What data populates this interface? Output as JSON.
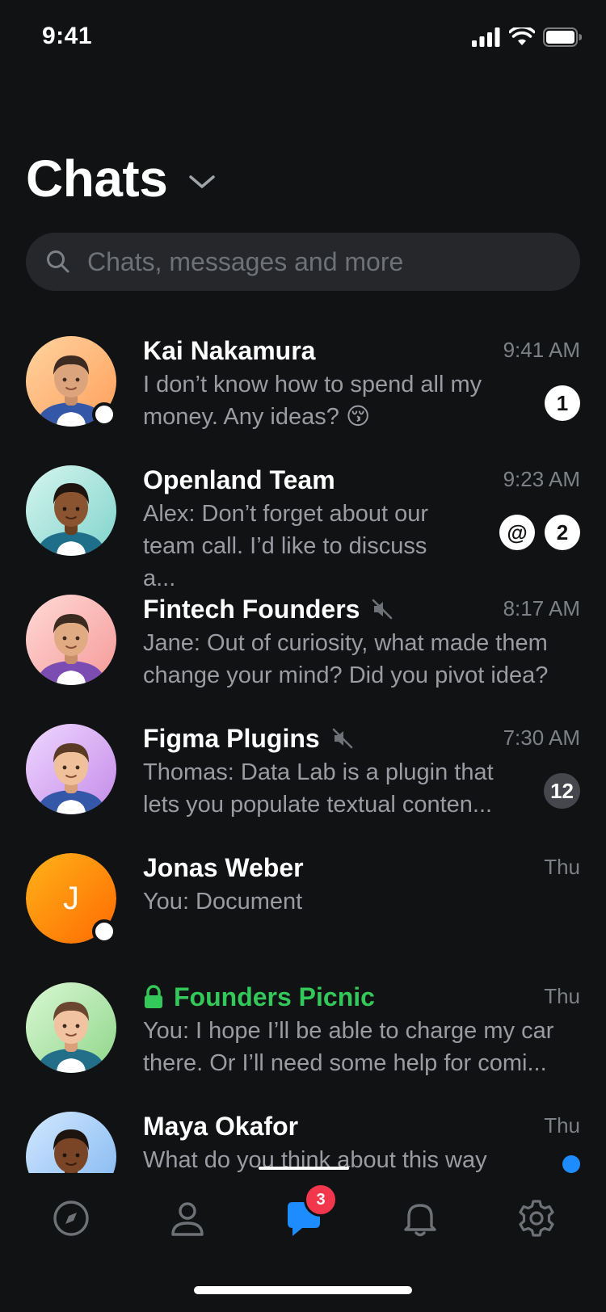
{
  "status_bar": {
    "time": "9:41"
  },
  "header": {
    "title": "Chats"
  },
  "search": {
    "placeholder": "Chats, messages and more"
  },
  "chats": [
    {
      "name": "Kai Nakamura",
      "time": "9:41 AM",
      "preview": "I don’t know how to spend all my money. Any ideas? 😚",
      "badges": [
        "1"
      ],
      "online": true,
      "muted": false
    },
    {
      "name": "Openland Team",
      "time": "9:23 AM",
      "preview": "Alex: Don’t forget about our team call. I’d like to discuss a...",
      "badges": [
        "@",
        "2"
      ],
      "online": false,
      "muted": false
    },
    {
      "name": "Fintech Founders",
      "time": "8:17 AM",
      "preview": "Jane: Out of curiosity, what made them change your mind? Did you pivot idea?",
      "badges": [],
      "online": false,
      "muted": true
    },
    {
      "name": "Figma Plugins",
      "time": "7:30 AM",
      "preview": "Thomas: Data Lab is a plugin that lets you populate textual conten...",
      "badges": [
        "12"
      ],
      "online": false,
      "muted": true
    },
    {
      "name": "Jonas Weber",
      "time": "Thu",
      "preview": "You: Document",
      "avatar_letter": "J",
      "badges": [],
      "online": true,
      "muted": false
    },
    {
      "name": "Founders Picnic",
      "time": "Thu",
      "preview": "You: I hope I’ll be able to charge my car there. Or I’ll need some help for comi...",
      "badges": [],
      "online": false,
      "muted": false,
      "secret": true
    },
    {
      "name": "Maya Okafor",
      "time": "Thu",
      "preview": "What do you think about this way",
      "badges": [],
      "online": false,
      "muted": false,
      "unread_dot": true
    }
  ],
  "tabbar": {
    "items": [
      {
        "id": "discover",
        "icon": "compass-icon"
      },
      {
        "id": "profile",
        "icon": "person-icon"
      },
      {
        "id": "chats",
        "icon": "chat-bubble-icon",
        "badge": "3",
        "active": true
      },
      {
        "id": "notifications",
        "icon": "bell-icon"
      },
      {
        "id": "settings",
        "icon": "gear-icon"
      }
    ]
  },
  "colors": {
    "background": "#111214",
    "accent": "#1c8cff",
    "secret_chat": "#34c759",
    "badge_red": "#f2364b"
  }
}
